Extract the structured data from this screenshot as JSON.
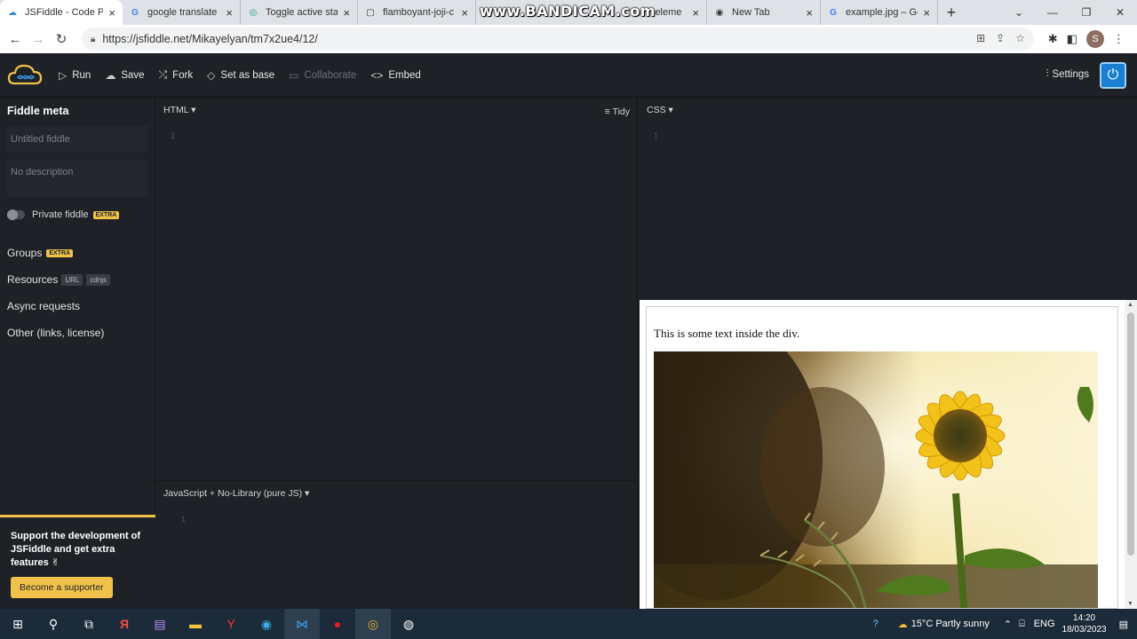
{
  "browser": {
    "tabs": [
      {
        "title": "JSFiddle - Code P",
        "icon": "jsfiddle-icon",
        "active": true
      },
      {
        "title": "google translate",
        "icon": "google-icon"
      },
      {
        "title": "Toggle active stat",
        "icon": "globe-icon"
      },
      {
        "title": "flamboyant-joji-c",
        "icon": "page-icon"
      },
      {
        "title": "eleme",
        "icon": "globe-icon"
      },
      {
        "title": "New Tab",
        "icon": "chrome-icon"
      },
      {
        "title": "example.jpg – Go",
        "icon": "google-icon"
      }
    ],
    "url": "https://jsfiddle.net/Mikayelyan/tm7x2ue4/12/",
    "profile_initial": "S"
  },
  "watermark": "www.BANDICAM.com",
  "toolbar": {
    "run": "Run",
    "save": "Save",
    "fork": "Fork",
    "set_as_base": "Set as base",
    "collaborate": "Collaborate",
    "embed": "Embed",
    "settings": "Settings"
  },
  "sidebar": {
    "title": "Fiddle meta",
    "title_placeholder": "Untitled fiddle",
    "description_placeholder": "No description",
    "private_label": "Private fiddle",
    "extra_badge": "EXTRA",
    "groups": "Groups",
    "resources": "Resources",
    "resources_url": "URL",
    "resources_cdnjs": "cdnjs",
    "async": "Async requests",
    "other": "Other (links, license)",
    "support_text": "Support the development of JSFiddle and get extra features ✌",
    "support_button": "Become a supporter"
  },
  "panels": {
    "html": "HTML ▾",
    "tidy": "Tidy",
    "css": "CSS ▾",
    "js": "JavaScript + No-Library (pure JS) ▾",
    "line": "1"
  },
  "result": {
    "text": "This is some text inside the div."
  },
  "taskbar": {
    "weather": "15°C  Partly sunny",
    "lang": "ENG",
    "time": "14:20",
    "date": "18/03/2023"
  },
  "colors": {
    "accent": "#f0c24b",
    "editor_bg": "#1e2126",
    "power_button": "#1a7fd0"
  }
}
